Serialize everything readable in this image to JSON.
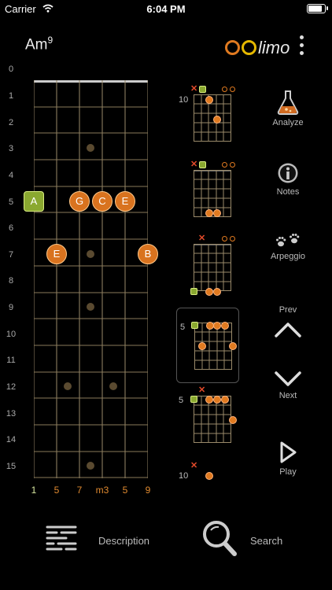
{
  "status": {
    "carrier": "Carrier",
    "time": "6:04 PM"
  },
  "chord": {
    "root": "Am",
    "ext": "9"
  },
  "logo": {
    "text": "limo"
  },
  "fret_numbers": [
    "0",
    "1",
    "2",
    "3",
    "4",
    "5",
    "6",
    "7",
    "8",
    "9",
    "10",
    "11",
    "12",
    "13",
    "14",
    "15"
  ],
  "string_labels": [
    "1",
    "5",
    "7",
    "m3",
    "5",
    "9"
  ],
  "notes": {
    "a": "A",
    "g": "G",
    "c": "C",
    "e5": "E",
    "e7": "E",
    "b": "B"
  },
  "voicings": [
    "10",
    "",
    "",
    "5",
    "5",
    "10"
  ],
  "side": {
    "analyze": "Analyze",
    "notes": "Notes",
    "arpeggio": "Arpeggio",
    "prev": "Prev",
    "next": "Next",
    "play": "Play"
  },
  "bottom": {
    "description": "Description",
    "search": "Search"
  },
  "colors": {
    "accent": "#d9731f",
    "root": "#8aa830",
    "x": "#e24a2a"
  }
}
